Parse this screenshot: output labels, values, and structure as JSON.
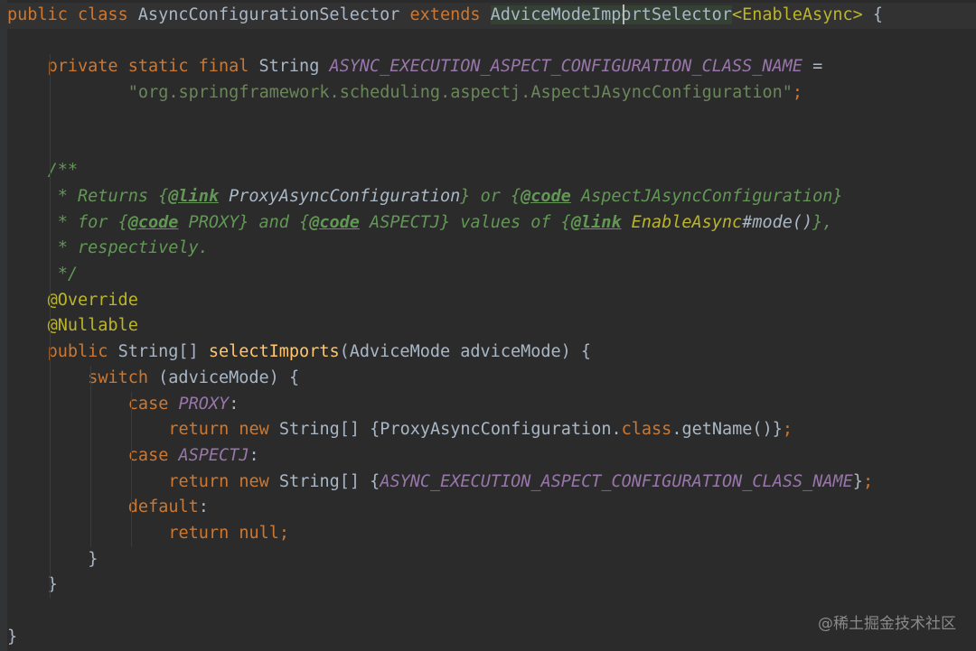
{
  "editor": {
    "colors": {
      "background": "#2b2b2b",
      "keyword": "#cc7832",
      "identifier": "#a9b7c6",
      "method": "#ffc66d",
      "constant": "#9876aa",
      "string": "#6a8759",
      "annotation": "#bbb529",
      "javadoc": "#629755"
    },
    "lines": [
      {
        "indent": 0,
        "tokens": [
          {
            "t": "public class ",
            "c": "kw"
          },
          {
            "t": "AsyncConfigurationSelector ",
            "c": "id"
          },
          {
            "t": "extends ",
            "c": "kw"
          },
          {
            "t": "AdviceModeImportSelector",
            "c": "id match-bg"
          },
          {
            "t": "<EnableAsync>",
            "c": "anno"
          },
          {
            "t": " {",
            "c": "punct"
          }
        ]
      },
      {
        "indent": 0,
        "tokens": []
      },
      {
        "indent": 4,
        "tokens": [
          {
            "t": "private static final ",
            "c": "kw"
          },
          {
            "t": "String ",
            "c": "type"
          },
          {
            "t": "ASYNC_EXECUTION_ASPECT_CONFIGURATION_CLASS_NAME",
            "c": "const"
          },
          {
            "t": " =",
            "c": "punct"
          }
        ]
      },
      {
        "indent": 12,
        "tokens": [
          {
            "t": "\"org.springframework.scheduling.aspectj.AspectJAsyncConfiguration\"",
            "c": "str"
          },
          {
            "t": ";",
            "c": "semi"
          }
        ]
      },
      {
        "indent": 0,
        "tokens": []
      },
      {
        "indent": 0,
        "tokens": []
      },
      {
        "indent": 4,
        "tokens": [
          {
            "t": "/**",
            "c": "doc"
          }
        ]
      },
      {
        "indent": 5,
        "tokens": [
          {
            "t": "* Returns {",
            "c": "doc"
          },
          {
            "t": "@link",
            "c": "doctag"
          },
          {
            "t": " ProxyAsyncConfiguration",
            "c": "docref"
          },
          {
            "t": "} or {",
            "c": "doc"
          },
          {
            "t": "@code",
            "c": "doctag"
          },
          {
            "t": " AspectJAsyncConfiguration}",
            "c": "doc"
          }
        ]
      },
      {
        "indent": 5,
        "tokens": [
          {
            "t": "* for {",
            "c": "doc"
          },
          {
            "t": "@code",
            "c": "doctag"
          },
          {
            "t": " PROXY} and {",
            "c": "doc"
          },
          {
            "t": "@code",
            "c": "doctag"
          },
          {
            "t": " ASPECTJ} values of {",
            "c": "doc"
          },
          {
            "t": "@link",
            "c": "doctag"
          },
          {
            "t": " EnableAsync",
            "c": "docref2"
          },
          {
            "t": "#mode()",
            "c": "docref"
          },
          {
            "t": "},",
            "c": "doc"
          }
        ]
      },
      {
        "indent": 5,
        "tokens": [
          {
            "t": "* respectively.",
            "c": "doc"
          }
        ]
      },
      {
        "indent": 5,
        "tokens": [
          {
            "t": "*/",
            "c": "doc"
          }
        ]
      },
      {
        "indent": 4,
        "tokens": [
          {
            "t": "@Override",
            "c": "anno"
          }
        ]
      },
      {
        "indent": 4,
        "tokens": [
          {
            "t": "@Nullable",
            "c": "anno"
          }
        ]
      },
      {
        "indent": 4,
        "tokens": [
          {
            "t": "public ",
            "c": "kw"
          },
          {
            "t": "String[] ",
            "c": "type"
          },
          {
            "t": "selectImports",
            "c": "fn"
          },
          {
            "t": "(AdviceMode adviceMode) {",
            "c": "punct"
          }
        ]
      },
      {
        "indent": 8,
        "tokens": [
          {
            "t": "switch ",
            "c": "kw"
          },
          {
            "t": "(adviceMode) {",
            "c": "punct"
          }
        ]
      },
      {
        "indent": 12,
        "tokens": [
          {
            "t": "case ",
            "c": "kw"
          },
          {
            "t": "PROXY",
            "c": "const"
          },
          {
            "t": ":",
            "c": "punct"
          }
        ]
      },
      {
        "indent": 16,
        "tokens": [
          {
            "t": "return new ",
            "c": "kw"
          },
          {
            "t": "String[] {ProxyAsyncConfiguration.",
            "c": "punct"
          },
          {
            "t": "class",
            "c": "kw"
          },
          {
            "t": ".getName()}",
            "c": "punct"
          },
          {
            "t": ";",
            "c": "semi"
          }
        ]
      },
      {
        "indent": 12,
        "tokens": [
          {
            "t": "case ",
            "c": "kw"
          },
          {
            "t": "ASPECTJ",
            "c": "const"
          },
          {
            "t": ":",
            "c": "punct"
          }
        ]
      },
      {
        "indent": 16,
        "tokens": [
          {
            "t": "return new ",
            "c": "kw"
          },
          {
            "t": "String[] {",
            "c": "punct"
          },
          {
            "t": "ASYNC_EXECUTION_ASPECT_CONFIGURATION_CLASS_NAME",
            "c": "const"
          },
          {
            "t": "}",
            "c": "punct"
          },
          {
            "t": ";",
            "c": "semi"
          }
        ]
      },
      {
        "indent": 12,
        "tokens": [
          {
            "t": "default",
            "c": "kw"
          },
          {
            "t": ":",
            "c": "punct"
          }
        ]
      },
      {
        "indent": 16,
        "tokens": [
          {
            "t": "return null;",
            "c": "kw"
          }
        ]
      },
      {
        "indent": 8,
        "tokens": [
          {
            "t": "}",
            "c": "punct"
          }
        ]
      },
      {
        "indent": 4,
        "tokens": [
          {
            "t": "}",
            "c": "punct"
          }
        ]
      },
      {
        "indent": 0,
        "tokens": []
      },
      {
        "indent": 0,
        "tokens": [
          {
            "t": "}",
            "c": "punct"
          }
        ]
      }
    ]
  },
  "watermark": {
    "text": "@稀土掘金技术社区"
  }
}
